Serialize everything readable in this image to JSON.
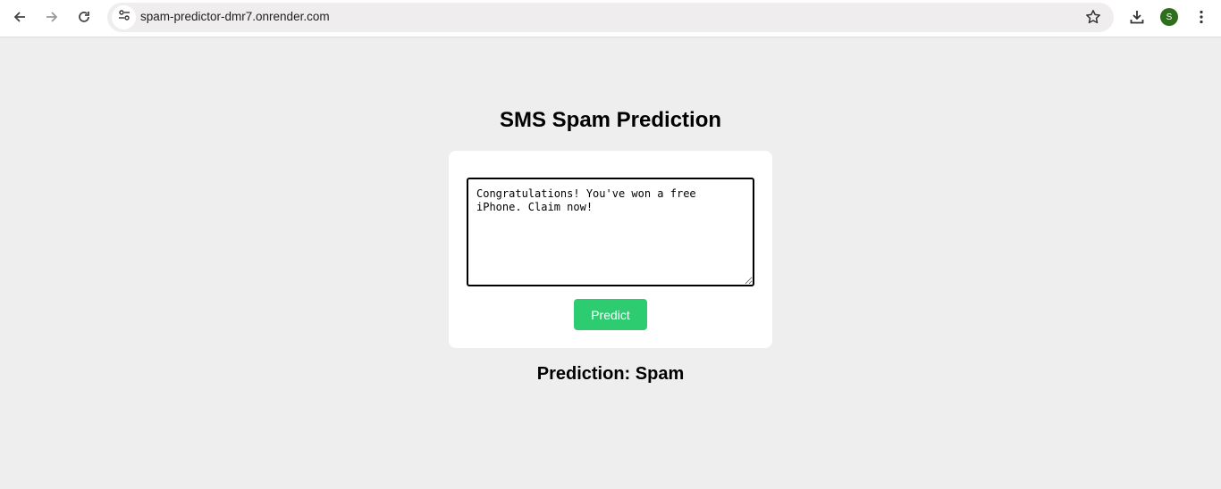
{
  "browser": {
    "url": "spam-predictor-dmr7.onrender.com",
    "profile_initial": "S",
    "icons": {
      "back": "back-arrow-icon",
      "forward": "forward-arrow-icon",
      "reload": "reload-icon",
      "site_info": "tune-icon",
      "bookmark": "star-icon",
      "download": "download-icon",
      "menu": "kebab-menu-icon"
    }
  },
  "page": {
    "title": "SMS Spam Prediction",
    "message_value": "Congratulations! You've won a free iPhone. Claim now!",
    "predict_label": "Predict",
    "result_text": "Prediction: Spam"
  },
  "colors": {
    "background": "#efeeee",
    "card": "#ffffff",
    "button": "#2ecc71",
    "avatar": "#2f6e1e"
  }
}
